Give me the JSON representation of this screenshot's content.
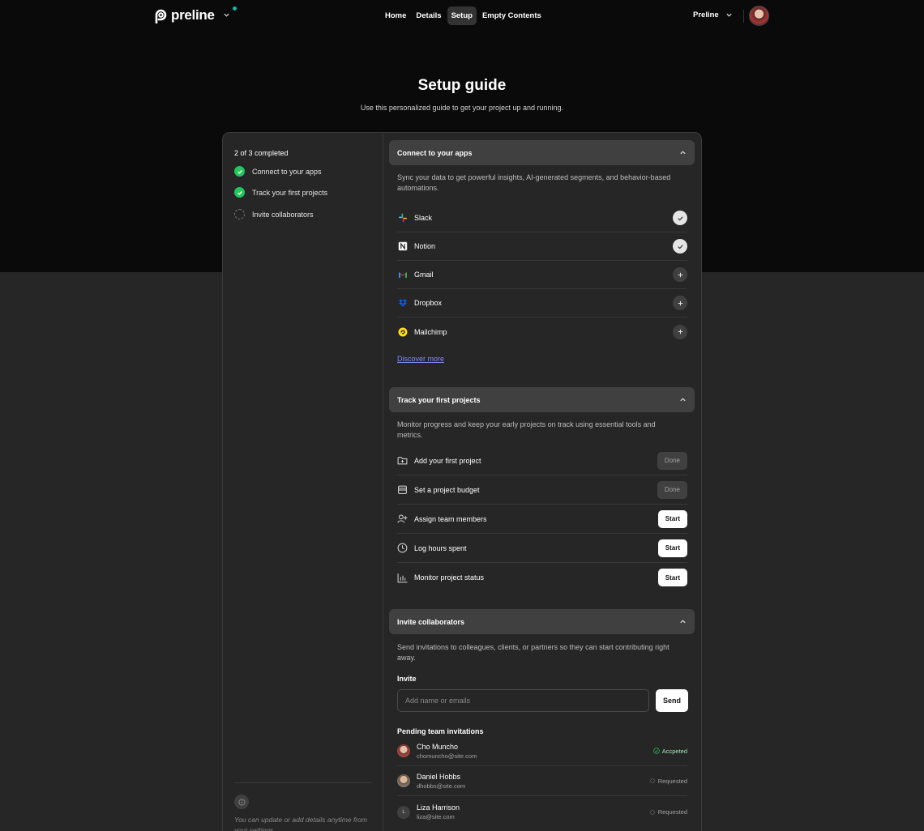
{
  "brand": {
    "name": "preline"
  },
  "nav": {
    "items": [
      "Home",
      "Details",
      "Setup",
      "Empty Contents"
    ],
    "active": "Setup"
  },
  "account": {
    "label": "Preline"
  },
  "page": {
    "title": "Setup guide",
    "subtitle": "Use this personalized guide to get your project up and running."
  },
  "sidebar": {
    "progress": "2 of 3 completed",
    "completed": 2,
    "total": 3,
    "steps": [
      {
        "label": "Connect to your apps",
        "done": true
      },
      {
        "label": "Track your first projects",
        "done": true
      },
      {
        "label": "Invite collaborators",
        "done": false
      }
    ],
    "note": "You can update or add details anytime from your settings."
  },
  "apps_section": {
    "title": "Connect to your apps",
    "description": "Sync your data to get powerful insights, AI-generated segments, and behavior-based automations.",
    "apps": [
      {
        "name": "Slack",
        "icon": "slack-icon",
        "connected": true
      },
      {
        "name": "Notion",
        "icon": "notion-icon",
        "connected": true
      },
      {
        "name": "Gmail",
        "icon": "gmail-icon",
        "connected": false
      },
      {
        "name": "Dropbox",
        "icon": "dropbox-icon",
        "connected": false
      },
      {
        "name": "Mailchimp",
        "icon": "mailchimp-icon",
        "connected": false
      }
    ],
    "discover": "Discover more"
  },
  "projects_section": {
    "title": "Track your first projects",
    "description": "Monitor progress and keep your early projects on track using essential tools and metrics.",
    "tasks": [
      {
        "label": "Add your first project",
        "icon": "folder-plus-icon",
        "action": "Done"
      },
      {
        "label": "Set a project budget",
        "icon": "wallet-icon",
        "action": "Done"
      },
      {
        "label": "Assign team members",
        "icon": "user-plus-icon",
        "action": "Start"
      },
      {
        "label": "Log hours spent",
        "icon": "clock-icon",
        "action": "Start"
      },
      {
        "label": "Monitor project status",
        "icon": "bar-chart-icon",
        "action": "Start"
      }
    ]
  },
  "invite_section": {
    "title": "Invite collaborators",
    "description": "Send invitations to colleagues, clients, or partners so they can start contributing right away.",
    "invite_label": "Invite",
    "input_placeholder": "Add name or emails",
    "send_label": "Send",
    "pending_title": "Pending team invitations",
    "people": [
      {
        "name": "Cho Muncho",
        "email": "chomuncho@site.com",
        "status": "Accpeted",
        "initial": ""
      },
      {
        "name": "Daniel Hobbs",
        "email": "dhobbs@site.com",
        "status": "Requested",
        "initial": ""
      },
      {
        "name": "Liza Harrison",
        "email": "liza@site.com",
        "status": "Requested",
        "initial": "L"
      }
    ]
  }
}
